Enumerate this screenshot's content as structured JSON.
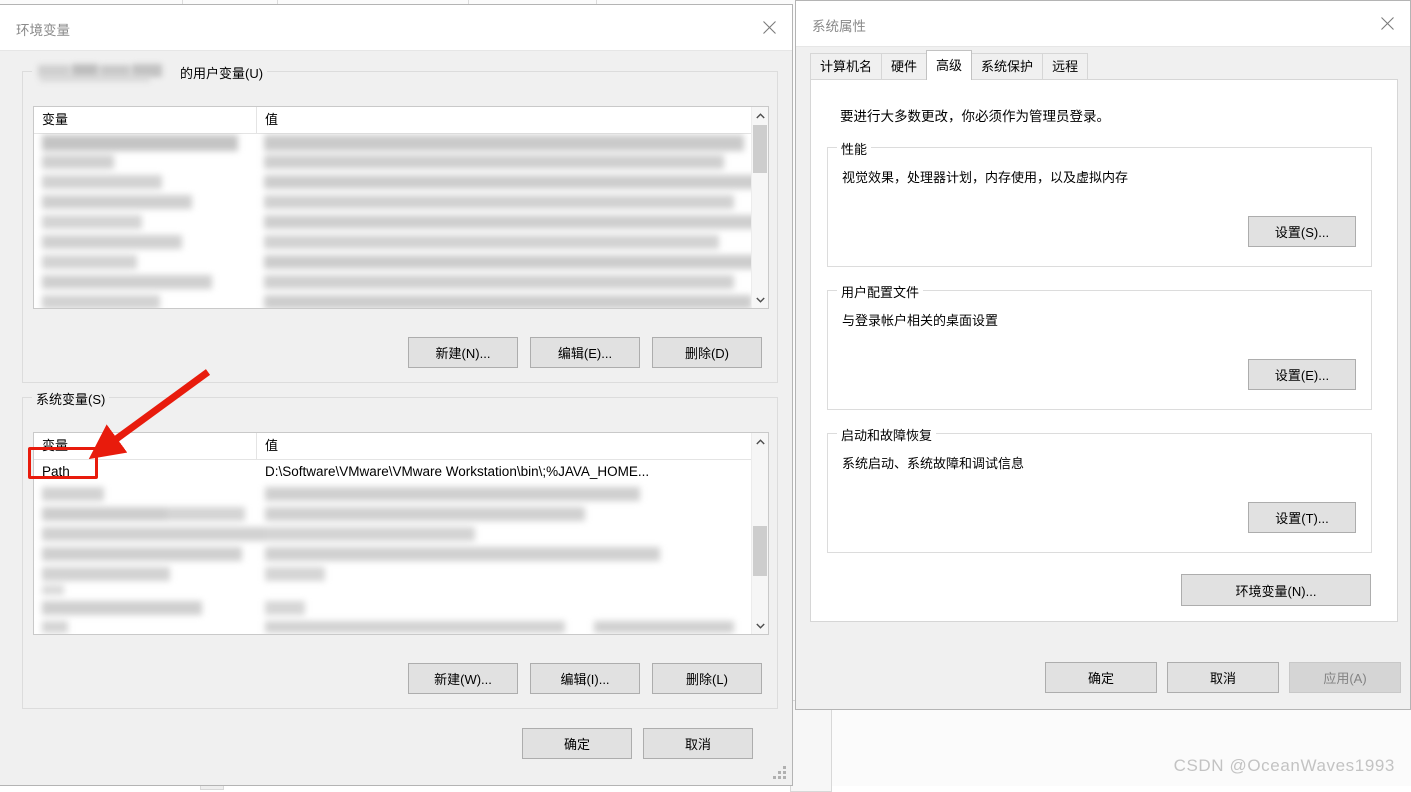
{
  "watermark": "CSDN @OceanWaves1993",
  "env_window": {
    "title": "环境变量",
    "close_icon": "close-icon",
    "user_section": {
      "label_suffix": "的用户变量(U)",
      "columns": {
        "name": "变量",
        "value": "值"
      },
      "rows": [],
      "buttons": {
        "new": "新建(N)...",
        "edit": "编辑(E)...",
        "delete": "删除(D)"
      }
    },
    "system_section": {
      "label": "系统变量(S)",
      "columns": {
        "name": "变量",
        "value": "值"
      },
      "rows": [
        {
          "name": "Path",
          "value": "D:\\Software\\VMware\\VMware Workstation\\bin\\;%JAVA_HOME...",
          "highlighted": true
        }
      ],
      "buttons": {
        "new": "新建(W)...",
        "edit": "编辑(I)...",
        "delete": "删除(L)"
      }
    },
    "footer": {
      "ok": "确定",
      "cancel": "取消"
    }
  },
  "sysprops_window": {
    "title": "系统属性",
    "close_icon": "close-icon",
    "tabs": [
      {
        "label": "计算机名",
        "active": false
      },
      {
        "label": "硬件",
        "active": false
      },
      {
        "label": "高级",
        "active": true
      },
      {
        "label": "系统保护",
        "active": false
      },
      {
        "label": "远程",
        "active": false
      }
    ],
    "notice": "要进行大多数更改，你必须作为管理员登录。",
    "groups": [
      {
        "label": "性能",
        "description": "视觉效果，处理器计划，内存使用，以及虚拟内存",
        "button": "设置(S)..."
      },
      {
        "label": "用户配置文件",
        "description": "与登录帐户相关的桌面设置",
        "button": "设置(E)..."
      },
      {
        "label": "启动和故障恢复",
        "description": "系统启动、系统故障和调试信息",
        "button": "设置(T)..."
      }
    ],
    "env_button": "环境变量(N)...",
    "footer": {
      "ok": "确定",
      "cancel": "取消",
      "apply": "应用(A)",
      "apply_disabled": true
    }
  },
  "annotation": {
    "color": "#e81b0c",
    "target": "Path",
    "shape": "arrow-pointing-to-path-row"
  }
}
